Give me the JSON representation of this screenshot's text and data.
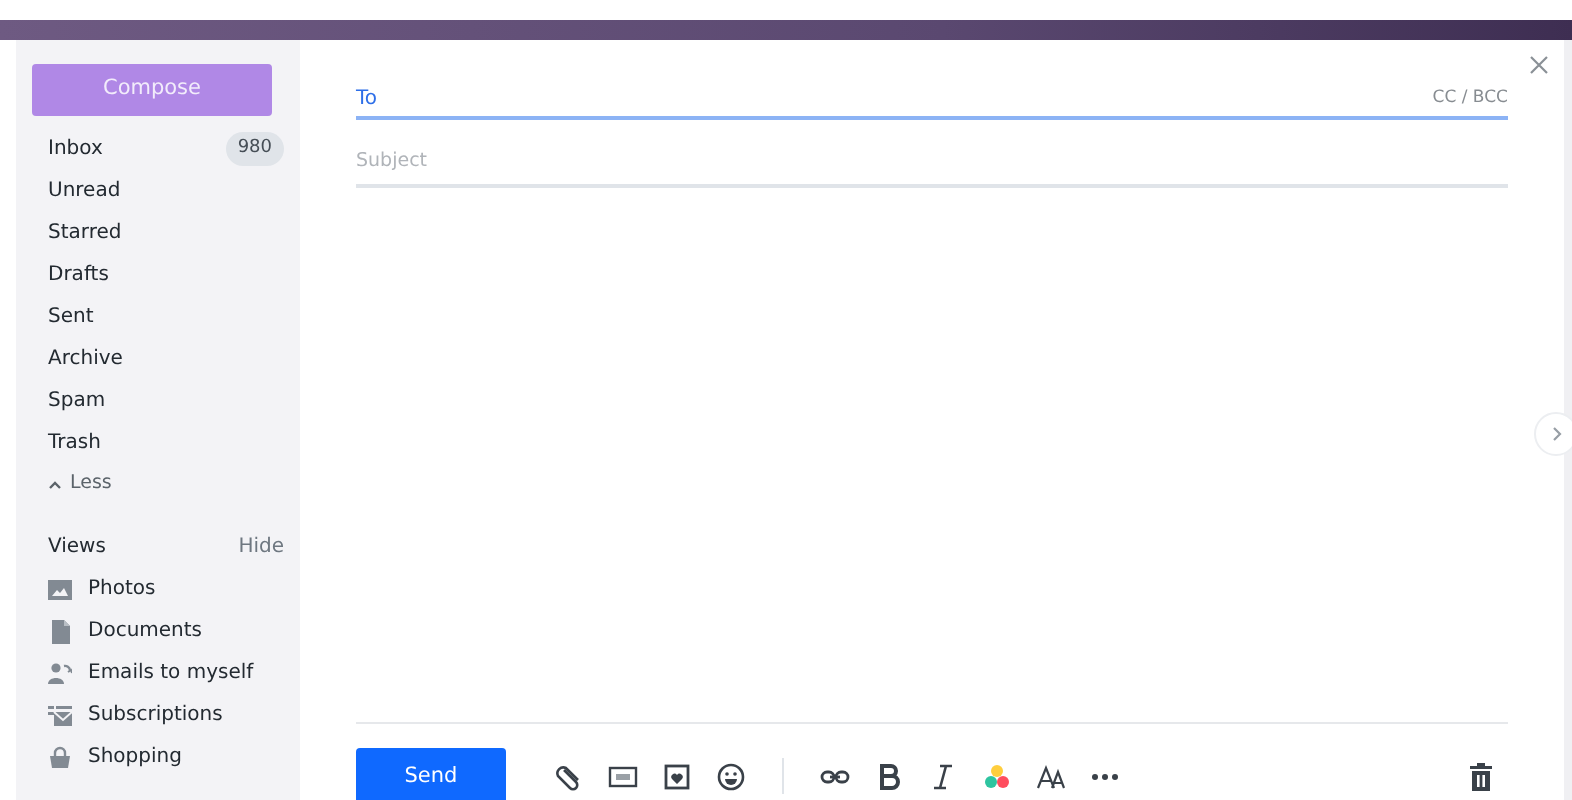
{
  "sidebar": {
    "compose": "Compose",
    "folders": [
      {
        "label": "Inbox",
        "count": "980"
      },
      {
        "label": "Unread"
      },
      {
        "label": "Starred"
      },
      {
        "label": "Drafts"
      },
      {
        "label": "Sent"
      },
      {
        "label": "Archive"
      },
      {
        "label": "Spam"
      },
      {
        "label": "Trash"
      }
    ],
    "less": "Less",
    "views": {
      "title": "Views",
      "hide": "Hide",
      "items": [
        {
          "label": "Photos"
        },
        {
          "label": "Documents"
        },
        {
          "label": "Emails to myself"
        },
        {
          "label": "Subscriptions"
        },
        {
          "label": "Shopping"
        }
      ]
    }
  },
  "compose": {
    "to_label": "To",
    "cc_bcc": "CC / BCC",
    "subject": {
      "placeholder": "Subject"
    },
    "send": "Send"
  }
}
